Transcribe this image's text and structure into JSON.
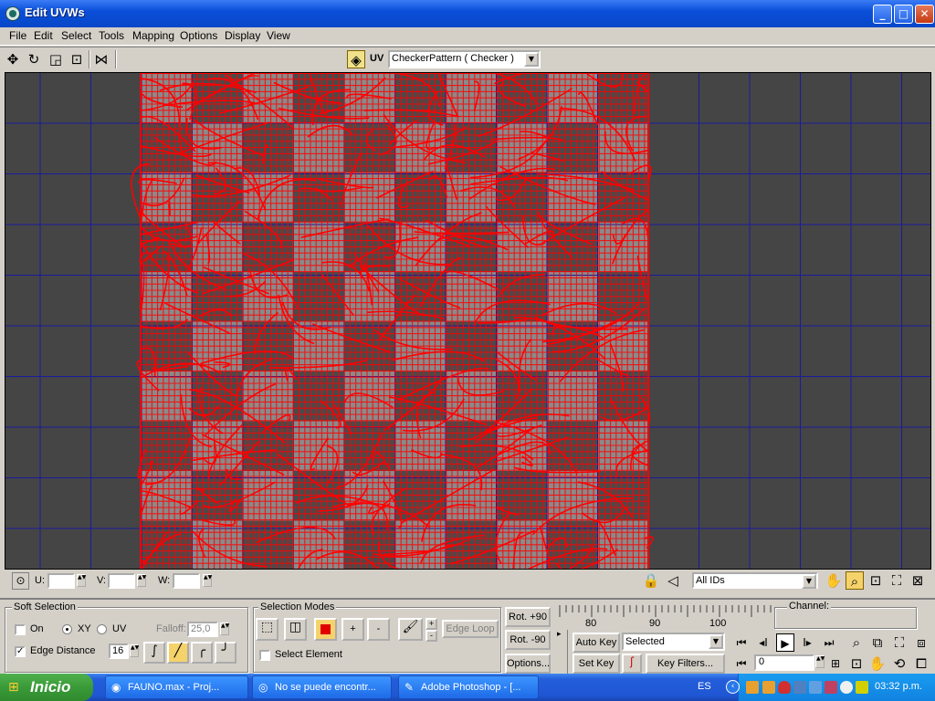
{
  "window": {
    "title": "Edit UVWs",
    "controls": {
      "minimize": "_",
      "maximize": "□",
      "close": "✕"
    }
  },
  "menu": [
    "File",
    "Edit",
    "Select",
    "Tools",
    "Mapping",
    "Options",
    "Display",
    "View"
  ],
  "toolbar": {
    "tools": [
      "move-icon",
      "rotate-icon",
      "scale-icon",
      "freeform-icon",
      "mirror-icon"
    ],
    "uv_label": "UV",
    "texture_select": "CheckerPattern  ( Checker )"
  },
  "status_row": {
    "u_label": "U:",
    "v_label": "V:",
    "w_label": "W:",
    "u_value": "",
    "v_value": "",
    "w_value": "",
    "id_filter": "All IDs"
  },
  "soft_selection": {
    "title": "Soft Selection",
    "on_label": "On",
    "on_checked": false,
    "xy_label": "XY",
    "xy_selected": true,
    "uv_label": "UV",
    "falloff_label": "Falloff:",
    "falloff_value": "25,0",
    "edge_distance_label": "Edge Distance",
    "edge_distance_checked": true,
    "edge_distance_value": "16"
  },
  "selection_modes": {
    "title": "Selection Modes",
    "plus_label": "+",
    "minus_label": "-",
    "edge_loop_label": "Edge Loop",
    "select_element_label": "Select Element"
  },
  "rotate": {
    "plus90": "Rot. +90",
    "minus90": "Rot. -90",
    "options": "Options..."
  },
  "timeline": {
    "ticks": [
      "80",
      "90",
      "100"
    ],
    "auto_key": "Auto Key",
    "set_key": "Set Key",
    "key_mode": "Selected",
    "key_filters": "Key Filters...",
    "frame": "0"
  },
  "channel": {
    "label": "Channel:"
  },
  "taskbar": {
    "start": "Inicio",
    "tasks": [
      {
        "label": "FAUNO.max      - Proj..."
      },
      {
        "label": "No se puede encontr..."
      },
      {
        "label": "Adobe Photoshop - [..."
      }
    ],
    "language": "ES",
    "clock": "03:32 p.m."
  },
  "colors": {
    "uv_wire": "#ff0000",
    "grid": "#1a1aa0",
    "viewport_bg": "#454545",
    "checker_light": "#8a8a8a",
    "checker_dark": "#4a4a4a",
    "accent_button": "#f5d26a"
  }
}
